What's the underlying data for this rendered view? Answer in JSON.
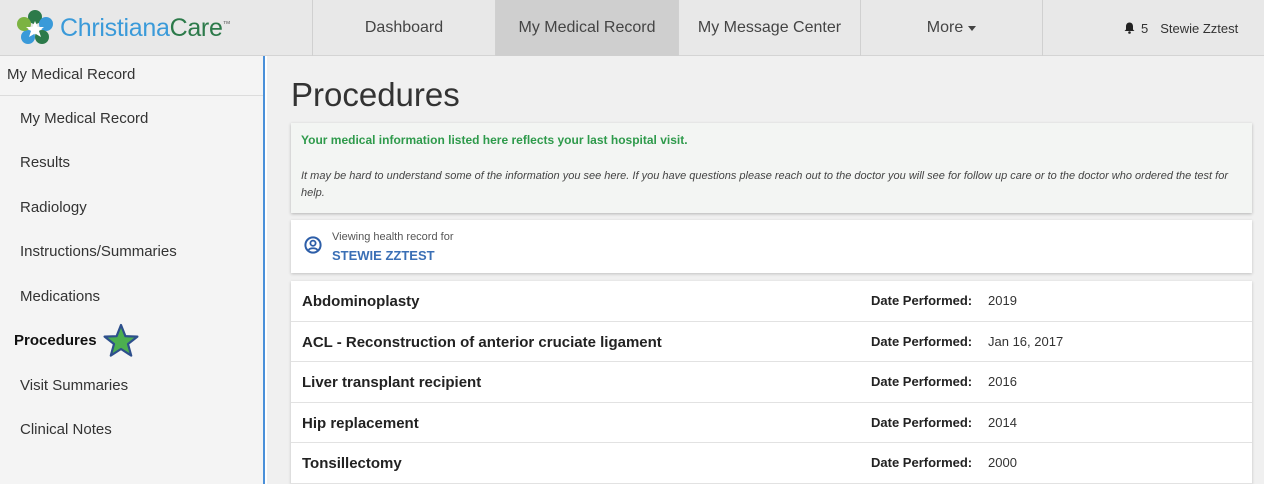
{
  "brand": {
    "name_part1": "Christiana",
    "name_part2": "Care",
    "trademark": "™"
  },
  "nav": {
    "items": [
      {
        "label": "Dashboard"
      },
      {
        "label": "My Medical Record",
        "active": true
      },
      {
        "label": "My Message Center"
      },
      {
        "label": "More"
      }
    ],
    "notification_count": "5",
    "user_name": "Stewie Zztest"
  },
  "sidebar": {
    "header": "My Medical Record",
    "items": [
      {
        "label": "My Medical Record"
      },
      {
        "label": "Results"
      },
      {
        "label": "Radiology"
      },
      {
        "label": "Instructions/Summaries"
      },
      {
        "label": "Medications"
      },
      {
        "label": "Procedures",
        "current": true
      },
      {
        "label": "Visit Summaries"
      },
      {
        "label": "Clinical Notes"
      }
    ]
  },
  "page": {
    "title": "Procedures",
    "info_main": "Your medical information listed here reflects your last hospital visit.",
    "info_sub": "It may be hard to understand some of the information you see here. If you have questions please reach out to the doctor you will see for follow up care or to the doctor who ordered the test for help.",
    "viewer_label": "Viewing health record for",
    "viewer_name": "STEWIE ZZTEST"
  },
  "procedures": {
    "date_label": "Date Performed:",
    "rows": [
      {
        "name": "Abdominoplasty",
        "date": "2019"
      },
      {
        "name": "ACL - Reconstruction of anterior cruciate ligament",
        "date": "Jan 16, 2017"
      },
      {
        "name": "Liver transplant recipient",
        "date": "2016"
      },
      {
        "name": "Hip replacement",
        "date": "2014"
      },
      {
        "name": "Tonsillectomy",
        "date": "2000"
      }
    ]
  },
  "colors": {
    "brand_blue": "#3a9ad9",
    "brand_green": "#2c7a4a",
    "info_green": "#2e9a4b",
    "link_blue": "#3a6fb5",
    "star_green": "#4caf50"
  },
  "icons": {
    "logo": "christianacare-flower-icon",
    "bell": "bell-icon",
    "user": "user-circle-icon",
    "star": "star-icon",
    "more_caret": "caret-down-icon"
  }
}
